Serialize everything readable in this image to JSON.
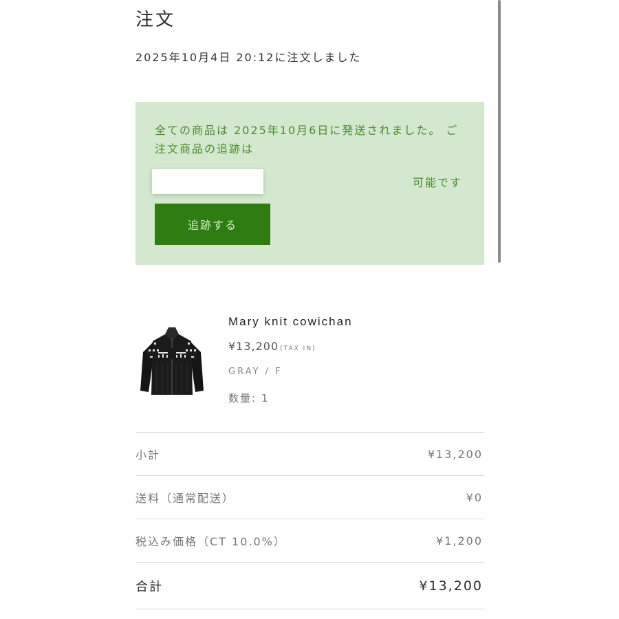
{
  "header": {
    "title": "注文",
    "order_date": "2025年10月4日 20:12に注文しました"
  },
  "notice": {
    "message": "全ての商品は 2025年10月6日に発送されました。 ご注文商品の追跡は",
    "tracking_value": "",
    "possible_text": "可能です",
    "button_label": "追跡する",
    "bg_color": "#d3e8ce",
    "button_color": "#2f7d12"
  },
  "product": {
    "image_icon": "black-knit-cardigan-thumbnail",
    "name": "Mary knit cowichan",
    "price": "¥13,200",
    "tax_note": "(TAX IN)",
    "variant": "GRAY / F",
    "quantity": "数量: 1"
  },
  "summary": {
    "rows": [
      {
        "label": "小計",
        "value": "¥13,200"
      },
      {
        "label": "送料（通常配送）",
        "value": "¥0"
      },
      {
        "label": "税込み価格（CT 10.0%）",
        "value": "¥1,200"
      }
    ],
    "total": {
      "label": "合計",
      "value": "¥13,200"
    }
  }
}
